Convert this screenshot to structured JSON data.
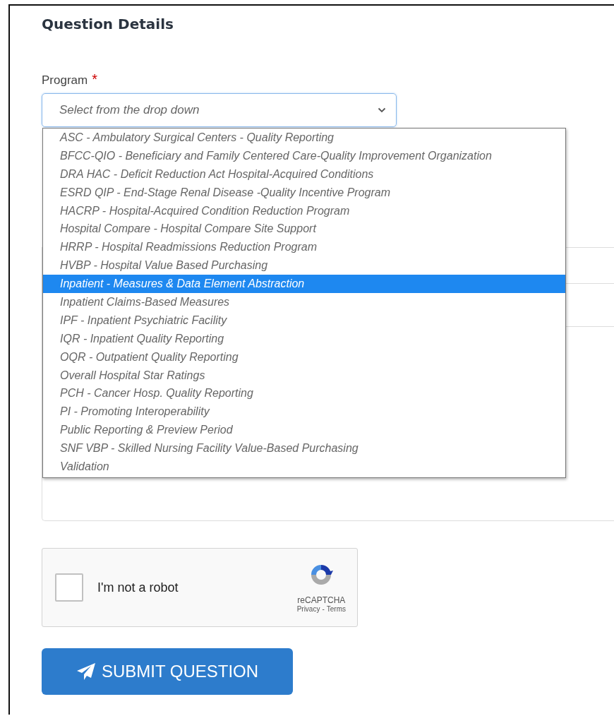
{
  "section_title": "Question Details",
  "program": {
    "label": "Program",
    "required_mark": "*",
    "placeholder": "Select from the drop down",
    "expanded": true,
    "options": [
      {
        "label": "ASC - Ambulatory Surgical Centers - Quality Reporting",
        "selected": false
      },
      {
        "label": "BFCC-QIO - Beneficiary and Family Centered Care-Quality Improvement Organization",
        "selected": false
      },
      {
        "label": "DRA HAC - Deficit Reduction Act Hospital-Acquired Conditions",
        "selected": false
      },
      {
        "label": "ESRD QIP - End-Stage Renal Disease -Quality Incentive Program",
        "selected": false
      },
      {
        "label": "HACRP - Hospital-Acquired Condition Reduction Program",
        "selected": false
      },
      {
        "label": "Hospital Compare - Hospital Compare Site Support",
        "selected": false
      },
      {
        "label": "HRRP - Hospital Readmissions Reduction Program",
        "selected": false
      },
      {
        "label": "HVBP - Hospital Value Based Purchasing",
        "selected": false
      },
      {
        "label": "Inpatient - Measures & Data Element Abstraction",
        "selected": true
      },
      {
        "label": "Inpatient Claims-Based Measures",
        "selected": false
      },
      {
        "label": "IPF - Inpatient Psychiatric Facility",
        "selected": false
      },
      {
        "label": "IQR - Inpatient Quality Reporting",
        "selected": false
      },
      {
        "label": "OQR - Outpatient Quality Reporting",
        "selected": false
      },
      {
        "label": "Overall Hospital Star Ratings",
        "selected": false
      },
      {
        "label": "PCH - Cancer Hosp. Quality Reporting",
        "selected": false
      },
      {
        "label": "PI - Promoting Interoperability",
        "selected": false
      },
      {
        "label": "Public Reporting & Preview Period",
        "selected": false
      },
      {
        "label": "SNF VBP - Skilled Nursing Facility Value-Based Purchasing",
        "selected": false
      },
      {
        "label": "Validation",
        "selected": false
      }
    ]
  },
  "captcha": {
    "label": "I'm not a robot",
    "checked": false,
    "brand": "reCAPTCHA",
    "links": [
      "Privacy",
      "Terms"
    ],
    "separator": "-"
  },
  "submit_button": {
    "label": "SUBMIT QUESTION"
  }
}
